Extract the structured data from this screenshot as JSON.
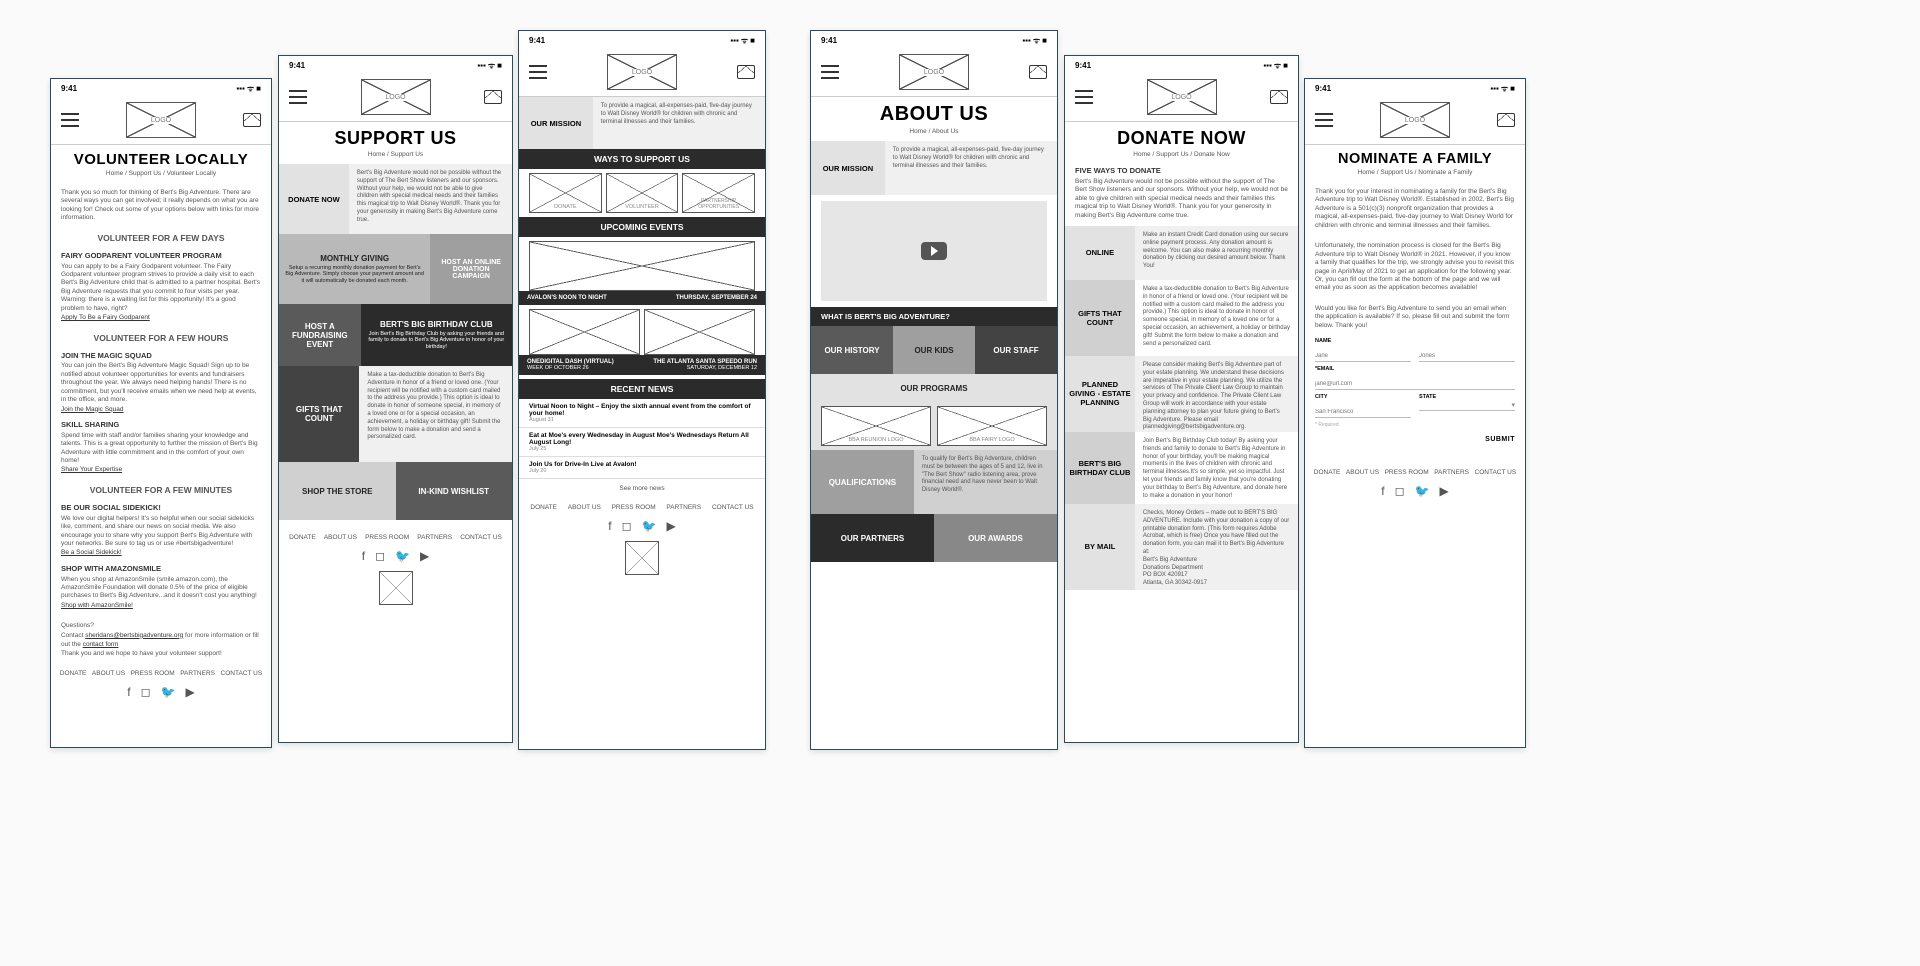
{
  "status": {
    "time": "9:41",
    "signal": "▪▪▪",
    "wifi": "ᯤ",
    "battery": "■"
  },
  "common": {
    "logo_label": "LOGO",
    "footer_nav": [
      "DONATE",
      "ABOUT US",
      "PRESS ROOM",
      "PARTNERS",
      "CONTACT US"
    ],
    "social": [
      "f",
      "◻",
      "🐦",
      "▶"
    ]
  },
  "screens": {
    "volunteer": {
      "title": "VOLUNTEER LOCALLY",
      "crumbs": "Home / Support Us / Volunteer Locally",
      "intro": "Thank you so much for thinking of Bert's Big Adventure. There are several ways you can get involved; it really depends on what you are looking for! Check out some of your options below with links for more information.",
      "sections": [
        {
          "heading": "VOLUNTEER FOR A FEW DAYS",
          "sub": "Fairy Godparent Volunteer Program",
          "body": "You can apply to be a Fairy Godparent volunteer. The Fairy Godparent volunteer program strives to provide a daily visit to each Bert's Big Adventure child that is admitted to a partner hospital. Bert's Big Adventure requests that you commit to four visits per year. Warning: there is a waiting list for this opportunity! It's a good problem to have, right?",
          "link": "Apply To Be a Fairy Godparent"
        },
        {
          "heading": "VOLUNTEER FOR A FEW HOURS",
          "sub": "Join the Magic Squad",
          "body": "You can join the Bert's Big Adventure Magic Squad! Sign up to be notified about volunteer opportunities for events and fundraisers throughout the year. We always need helping hands! There is no commitment, but you'll receive emails when we need help at events, in the office, and more.",
          "link": "Join the Magic Squad",
          "sub2": "Skill Sharing",
          "body2": "Spend time with staff and/or families sharing your knowledge and talents. This is a great opportunity to further the mission of Bert's Big Adventure with little commitment and in the comfort of your own home!",
          "link2": "Share Your Expertise"
        },
        {
          "heading": "VOLUNTEER FOR A FEW MINUTES",
          "sub": "Be our Social Sidekick!",
          "body": "We love our digital helpers! It's so helpful when our social sidekicks like, comment, and share our news on social media. We also encourage you to share why you support Bert's Big Adventure with your networks. Be sure to tag us or use #bertsbigadventure!",
          "link": "Be a Social Sidekick!",
          "sub2": "Shop with AmazonSmile",
          "body2": "When you shop at AmazonSmile (smile.amazon.com), the AmazonSmile Foundation will donate 0.5% of the price of eligible purchases to Bert's Big Adventure...and it doesn't cost you anything!",
          "link2": "Shop with AmazonSmile!"
        }
      ],
      "footer_text": {
        "q": "Questions?",
        "line1a": "Contact ",
        "email": "sheridans@bertsbigadventure.org",
        "line1b": " for more information or fill out the ",
        "contact": "contact form",
        "line2": "Thank you and we hope to have your volunteer support!"
      }
    },
    "support": {
      "title": "SUPPORT US",
      "crumbs": "Home / Support Us",
      "donate_now_label": "DONATE NOW",
      "donate_now_desc": "Bert's Big Adventure would not be possible without the support of The Bert Show listeners and our sponsors. Without your help, we would not be able to give children with special medical needs and their families this magical trip to Walt Disney World®. Thank you for your generosity in making Bert's Big Adventure come true.",
      "tiles": [
        {
          "label": "MONTHLY GIVING",
          "desc": "Setup a recurring monthly donation payment for Bert's Big Adventure. Simply choose your payment amount and it will automatically be donated each month."
        },
        {
          "label": "HOST AN ONLINE DONATION CAMPAIGN"
        },
        {
          "label": "HOST A FUNDRAISING EVENT"
        },
        {
          "label": "BERT'S BIG BIRTHDAY CLUB",
          "desc": "Join Bert's Big Birthday Club by asking your friends and family to donate to Bert's Big Adventure in honor of your birthday!"
        },
        {
          "label": "GIFTS THAT COUNT",
          "desc": "Make a tax-deductible donation to Bert's Big Adventure in honor of a friend or loved one. (Your recipient will be notified with a custom card mailed to the address you provide.) This option is ideal to donate in honor of someone special, in memory of a loved one or for a special occasion, an achievement, a holiday or birthday gift! Submit the form below to make a donation and send a personalized card."
        },
        {
          "label": "SHOP THE STORE"
        },
        {
          "label": "IN-KIND WISHLIST"
        }
      ]
    },
    "home": {
      "mission_label": "OUR MISSION",
      "mission_text": "To provide a magical, all-expenses-paid, five-day journey to Walt Disney World® for children with chronic and terminal illnesses and their families.",
      "ways_heading": "WAYS TO SUPPORT US",
      "way_donate": "DONATE",
      "way_volunteer": "VOLUNTEER",
      "way_partner": "PARTNERSHIP OPPORTUNITIES",
      "upcoming_heading": "UPCOMING EVENTS",
      "events": [
        {
          "left": "AVALON'S NOON TO NIGHT",
          "right": "THURSDAY, SEPTEMBER 24"
        },
        {
          "left": "ONEDIGITAL DASH (VIRTUAL)",
          "left_sub": "WEEK OF OCTOBER 26",
          "right": "THE ATLANTA SANTA SPEEDO RUN",
          "right_sub": "SATURDAY, DECEMBER 12"
        }
      ],
      "recent_heading": "RECENT NEWS",
      "news": [
        {
          "t": "Virtual Noon to Night – Enjoy the sixth annual event from the comfort of your home!",
          "d": "August 31"
        },
        {
          "t": "Eat at Moe's every Wednesday in August Moe's Wednesdays Return All August Long!",
          "d": "July 25"
        },
        {
          "t": "Join Us for Drive-In Live at Avalon!",
          "d": "July 20"
        }
      ],
      "see_more": "See more news"
    },
    "about": {
      "title": "ABOUT US",
      "crumbs": "Home / About Us",
      "mission_label": "OUR MISSION",
      "mission_text": "To provide a magical, all-expenses-paid, five-day journey to Walt Disney World® for children with chronic and terminal illnesses and their families.",
      "what_is": "WHAT IS BERT'S BIG ADVENTURE?",
      "tiles1": [
        "OUR HISTORY",
        "OUR KIDS",
        "OUR STAFF"
      ],
      "programs_heading": "OUR PROGRAMS",
      "program_logos": [
        "BBA REUNION LOGO",
        "BBA FAIRY LOGO"
      ],
      "qual_label": "QUALIFICATIONS",
      "qual_text": "To qualify for Bert's Big Adventure, children must be between the ages of 5 and 12, live in \"The Bert Show\" radio listening area, prove financial need and have never been to Walt Disney World®.",
      "tiles2": [
        "OUR PARTNERS",
        "OUR AWARDS"
      ]
    },
    "donate": {
      "title": "DONATE NOW",
      "crumbs": "Home / Support Us / Donate Now",
      "five_heading": "FIVE WAYS TO DONATE",
      "intro": "Bert's Big Adventure would not be possible without the support of The Bert Show listeners and our sponsors. Without your help, we would not be able to give children with special medical needs and their families this magical trip to Walt Disney World®. Thank you for your generosity in making Bert's Big Adventure come true.",
      "rows": [
        {
          "label": "ONLINE",
          "desc": "Make an instant Credit Card donation using our secure online payment process. Any donation amount is welcome. You can also make a recurring monthly donation by clicking our desired amount below. Thank You!"
        },
        {
          "label": "GIFTS THAT COUNT",
          "desc": "Make a tax-deductible donation to Bert's Big Adventure in honor of a friend or loved one. (Your recipient will be notified with a custom card mailed to the address you provide.) This option is ideal to donate in honor of someone special, in memory of a loved one or for a special occasion, an achievement, a holiday or birthday gift! Submit the form below to make a donation and send a personalized card."
        },
        {
          "label": "PLANNED GIVING - ESTATE PLANNING",
          "desc": "Please consider making Bert's Big Adventure part of your estate planning. We understand these decisions are imperative in your estate planning. We utilize the services of The Private Client Law Group to maintain your privacy and confidence. The Private Client Law Group will work in accordance with your estate planning attorney to plan your future giving to Bert's Big Adventure. Please email plannedgiving@bertsbigadventure.org."
        },
        {
          "label": "BERT'S BIG BIRTHDAY CLUB",
          "desc": "Join Bert's Big Birthday Club today! By asking your friends and family to donate to Bert's Big Adventure in honor of your birthday, you'll be making magical moments in the lives of children with chronic and terminal illnesses.It's so simple, yet so impactful. Just let your friends and family know that you're donating your birthday to Bert's Big Adventure, and donate here to make a donation in your honor!"
        },
        {
          "label": "BY MAIL",
          "desc": "Checks, Money Orders – made out to BERT'S BIG ADVENTURE. Include with your donation a copy of our printable donation form. (This form requires Adobe Acrobat, which is free) Once you have filled out the donation form, you can mail it to Bert's Big Adventure at:\nBert's Big Adventure\nDonations Department\nPO BOX 420917\nAtlanta, GA 30342-0917"
        }
      ]
    },
    "nominate": {
      "title": "NOMINATE A FAMILY",
      "crumbs": "Home / Support Us / Nominate a Family",
      "p1": "Thank you for your interest in nominating a family for the Bert's Big Adventure trip to Walt Disney World®. Established in 2002, Bert's Big Adventure is a 501(c)(3) nonprofit organization that provides a magical, all-expenses-paid, five-day journey to Walt Disney World for children with chronic and terminal illnesses and their families.",
      "p2": "Unfortunately, the nomination process is closed for the Bert's Big Adventure trip to Walt Disney World® in 2021. However, if you know a family that qualifies for the trip, we strongly advise you to revisit this page in April/May of 2021 to get an application for the following year. Or, you can fill out the form at the bottom of the page and we will email you as soon as the application becomes available!",
      "p3": "Would you like for Bert's Big Adventure to send you an email when the application is available? If so, please fill out and submit the form below. Thank you!",
      "form": {
        "name_label": "NAME",
        "name_first_ph": "Jane",
        "name_last_ph": "Jones",
        "email_label": "*EMAIL",
        "email_ph": "jane@url.com",
        "city_label": "CITY",
        "city_ph": "San Francisco",
        "state_label": "STATE",
        "required": "* Required",
        "submit": "SUBMIT"
      }
    }
  }
}
